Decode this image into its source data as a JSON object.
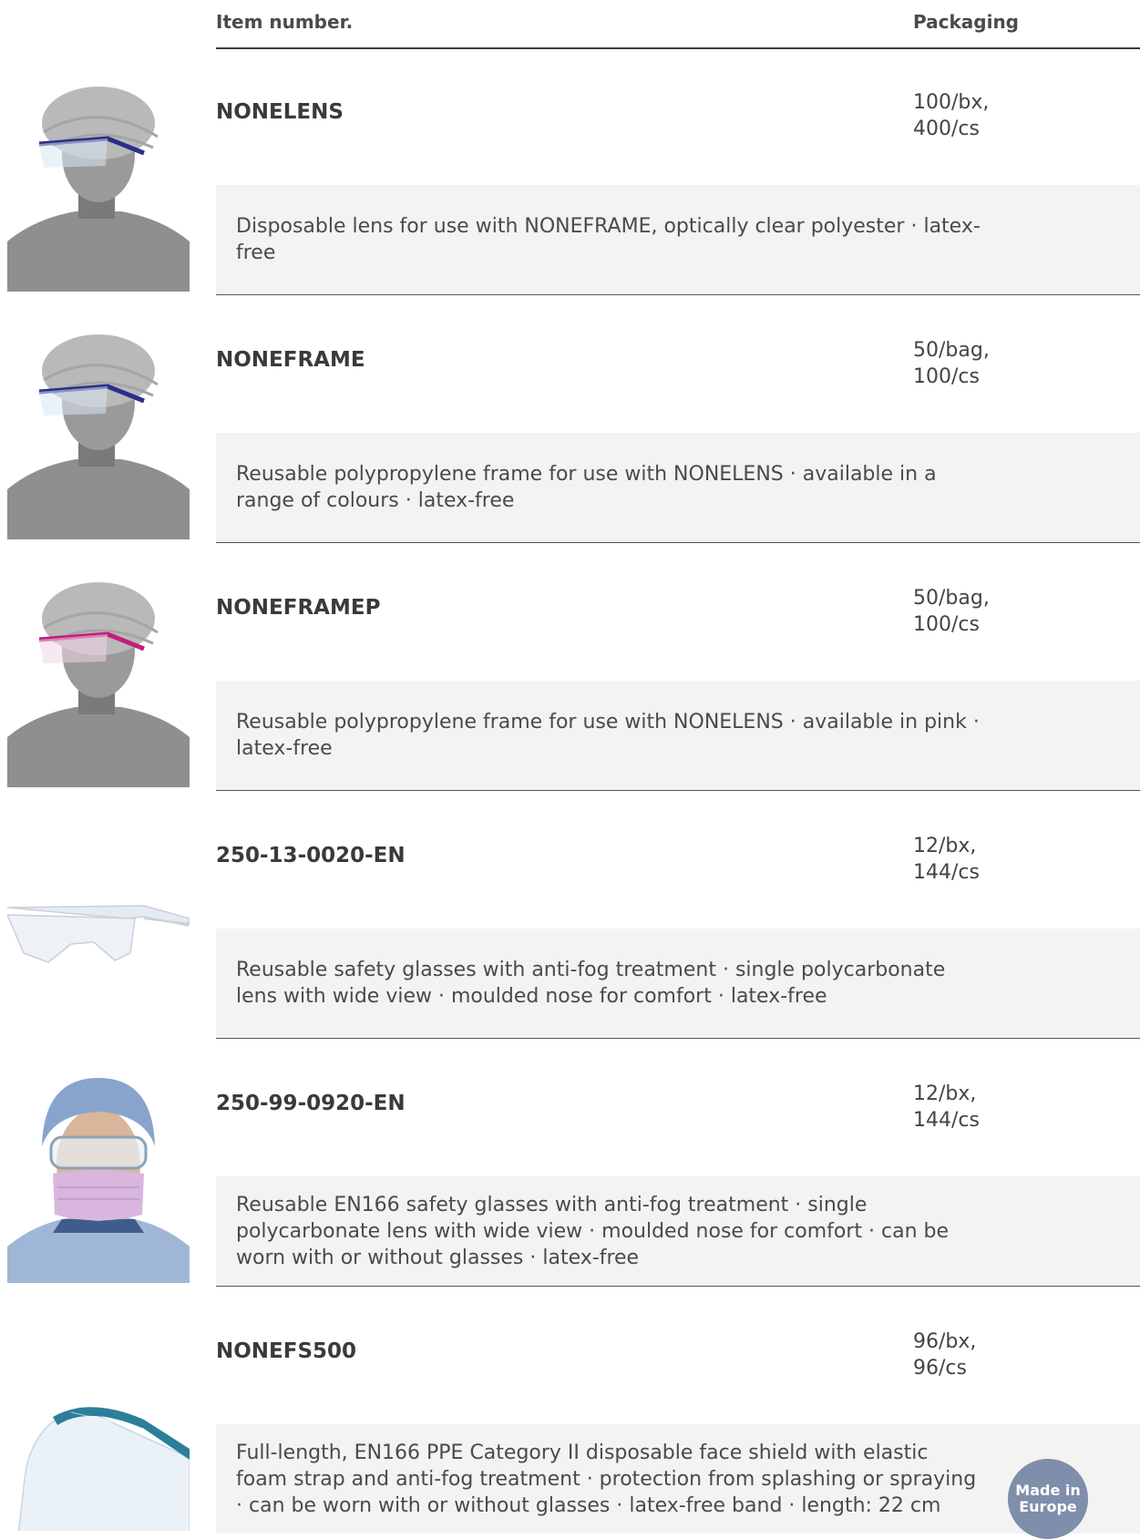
{
  "header": {
    "item_number": "Item number.",
    "packaging": "Packaging"
  },
  "products": [
    {
      "code": "NONELENS",
      "packaging": [
        "100/bx,",
        "400/cs"
      ],
      "description": "Disposable lens for use with NONEFRAME, optically clear polyester · latex-free",
      "image": "person-with-lens-frame",
      "frame_color": "#2a2f8a"
    },
    {
      "code": "NONEFRAME",
      "packaging": [
        "50/bag,",
        "100/cs"
      ],
      "description": "Reusable polypropylene frame for use with NONELENS · available in a range of colours · latex-free",
      "image": "person-with-lens-frame",
      "frame_color": "#2a2f8a"
    },
    {
      "code": "NONEFRAMEP",
      "packaging": [
        "50/bag,",
        "100/cs"
      ],
      "description": "Reusable polypropylene frame for use with NONELENS · available in pink · latex-free",
      "image": "person-with-lens-frame",
      "frame_color": "#c21f7a"
    },
    {
      "code": "250-13-0020-EN",
      "packaging": [
        "12/bx,",
        "144/cs"
      ],
      "description": "Reusable safety glasses with anti-fog treatment · single polycarbonate lens with wide view · moulded nose for comfort · latex-free",
      "image": "clear-safety-glasses"
    },
    {
      "code": "250-99-0920-EN",
      "packaging": [
        "12/bx,",
        "144/cs"
      ],
      "description": "Reusable EN166 safety glasses with anti-fog treatment · single polycarbonate lens with wide view · moulded nose for comfort · can be worn with or without glasses · latex-free",
      "image": "person-with-goggles-and-mask"
    },
    {
      "code": "NONEFS500",
      "packaging": [
        "96/bx,",
        "96/cs"
      ],
      "description": "Full-length, EN166 PPE Category II disposable face shield with elastic foam strap and anti-fog treatment · protection from splashing or spraying · can be worn with or without glasses · latex-free band · length: 22 cm",
      "image": "face-shield",
      "badge": "Made in Europe"
    }
  ]
}
